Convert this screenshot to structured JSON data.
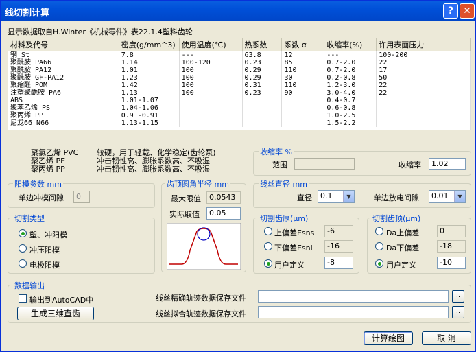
{
  "window": {
    "title": "线切割计算",
    "help": "?",
    "close": "✕"
  },
  "source_note": "显示数据取自H.Winter《机械零件》表22.1.4塑料齿轮",
  "table": {
    "headers": [
      "材料及代号",
      "密度(g/mm^3)",
      "使用温度(℃)",
      "热系数",
      "系数 α",
      "收缩率(%)",
      "许用表面压力"
    ],
    "rows": [
      [
        "钢 St",
        "7.8",
        "---",
        "63.8",
        "12",
        "---",
        "100-200"
      ],
      [
        "聚酰胺 PA66",
        "1.14",
        "100-120",
        "0.23",
        "85",
        "0.7-2.0",
        "22"
      ],
      [
        "聚酰胺 PA12",
        "1.01",
        "100",
        "0.29",
        "110",
        "0.7-2.0",
        "17"
      ],
      [
        "聚酰胺 GF-PA12",
        "1.23",
        "100",
        "0.29",
        "30",
        "0.2-0.8",
        "50"
      ],
      [
        "聚缩醛 POM",
        "1.42",
        "100",
        "0.31",
        "110",
        "1.2-3.0",
        "22"
      ],
      [
        "注塑聚酰胺 PA6",
        "1.13",
        "100",
        "0.23",
        "90",
        "3.0-4.0",
        "22"
      ],
      [
        "ABS",
        "1.01-1.07",
        "",
        "",
        "",
        "0.4-0.7",
        ""
      ],
      [
        "聚苯乙烯 PS",
        "1.04-1.06",
        "",
        "",
        "",
        "0.6-0.8",
        ""
      ],
      [
        "聚丙烯 PP",
        "0.9 -0.91",
        "",
        "",
        "",
        "1.0-2.5",
        ""
      ],
      [
        "尼龙66 N66",
        "1.13-1.15",
        "",
        "",
        "",
        "1.5-2.2",
        ""
      ]
    ]
  },
  "notes": [
    {
      "name": "聚氯乙烯 PVC",
      "desc": "较硬，用于轻载、化学稳定(齿轮泵)"
    },
    {
      "name": "聚乙烯 PE",
      "desc": "冲击韧性高、膨胀系数高、不吸湿"
    },
    {
      "name": "聚丙烯 PP",
      "desc": "冲击韧性高、膨胀系数高、不吸湿"
    }
  ],
  "shrink": {
    "title": "收缩率 %",
    "range_label": "范围",
    "range_value": "",
    "rate_label": "收缩率",
    "rate_value": "1.02"
  },
  "die": {
    "title": "阳模参数 mm",
    "gap_label": "单边冲模间隙",
    "gap_value": "0"
  },
  "tip": {
    "title": "齿顶圆角半径 mm",
    "max_label": "最大限值",
    "max_value": "0.0543",
    "actual_label": "实际取值",
    "actual_value": "0.05"
  },
  "wire": {
    "title": "线丝直径 mm",
    "dia_label": "直径",
    "dia_value": "0.1",
    "gap_label": "单边放电间隙",
    "gap_value": "0.01"
  },
  "cut_type": {
    "title": "切割类型",
    "options": [
      "塑、冲阳模",
      "冲压阳模",
      "电极阳模"
    ],
    "selected": 0
  },
  "thickness": {
    "title": "切割齿厚(μm)",
    "upper_label": "上偏差Esns",
    "upper_value": "-6",
    "lower_label": "下偏差Esni",
    "lower_value": "-16",
    "user_label": "用户定义",
    "user_value": "-8"
  },
  "tooth_tip": {
    "title": "切割齿顶(μm)",
    "upper_label": "Da上偏差",
    "upper_value": "0",
    "lower_label": "Da下偏差",
    "lower_value": "-18",
    "user_label": "用户定义",
    "user_value": "-10"
  },
  "output": {
    "title": "数据输出",
    "autocad_label": "输出到AutoCAD中",
    "gen3d_label": "生成三维直齿",
    "precise_label": "线丝精确轨迹数据保存文件",
    "fit_label": "线丝拟合轨迹数据保存文件",
    "browse": ".."
  },
  "buttons": {
    "calc": "计算绘图",
    "cancel": "取 消"
  },
  "colors": {
    "title_bar": "#0050d8",
    "group_title": "#0046d5",
    "profile_line": "#c00000"
  }
}
